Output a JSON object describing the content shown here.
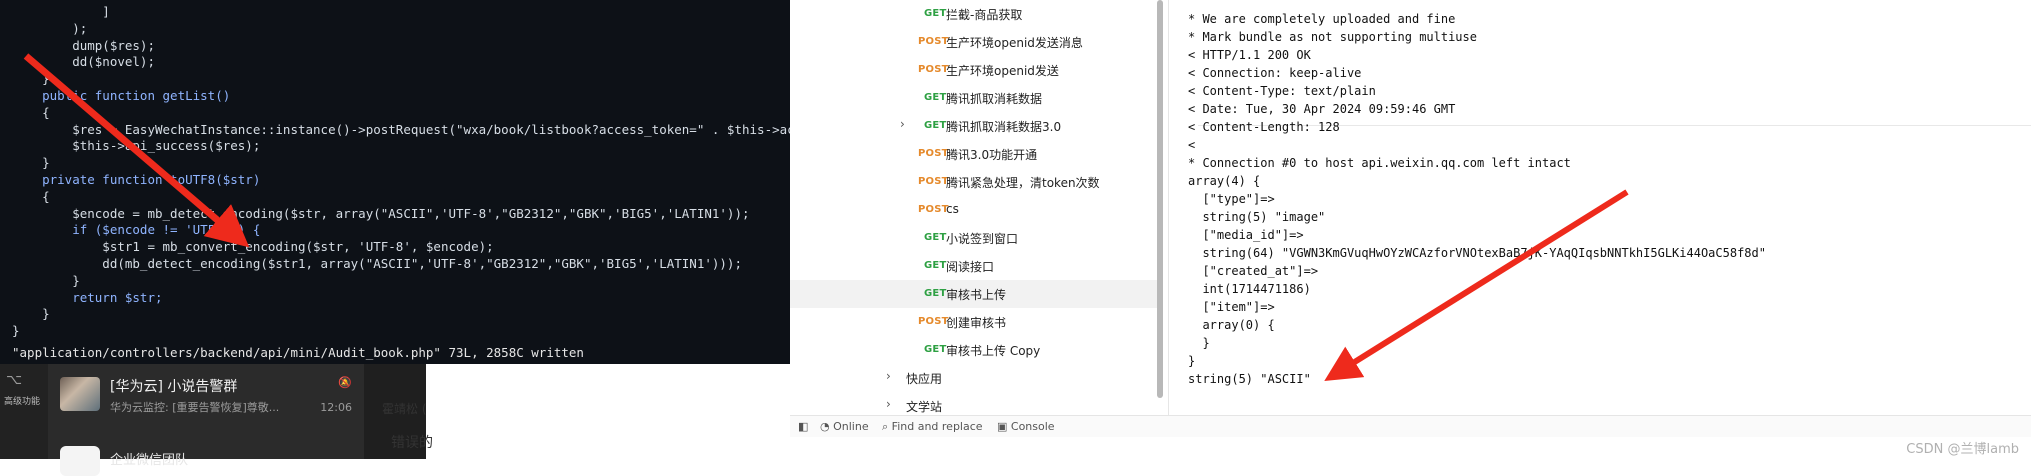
{
  "editor": {
    "lines": [
      "            ]",
      "        );",
      "        dump($res);",
      "        dd($novel);",
      "    }",
      "    public function getList()",
      "    {",
      "        $res = EasyWechatInstance::instance()->postRequest(\"wxa/book/listbook?access_token=\" . $this->access_to",
      "        $this->api_success($res);",
      "    }",
      "    private function toUTF8($str)",
      "    {",
      "        $encode = mb_detect_encoding($str, array(\"ASCII\",'UTF-8',\"GB2312\",\"GBK\",'BIG5','LATIN1'));",
      "        if ($encode != 'UTF-8') {",
      "            $str1 = mb_convert_encoding($str, 'UTF-8', $encode);",
      "            dd(mb_detect_encoding($str1, array(\"ASCII\",'UTF-8',\"GB2312\",\"GBK\",'BIG5','LATIN1')));",
      "        }",
      "        return $str;",
      "    }",
      "}"
    ],
    "status_line": "\"application/controllers/backend/api/mini/Audit_book.php\" 73L, 2858C written"
  },
  "chat": {
    "side_label": "高级功能",
    "items": [
      {
        "name": "[华为云] 小说告警群",
        "preview": "华为云监控: [重要告警恢复]尊敬...",
        "time": "12:06"
      },
      {
        "name": "企业微信团队",
        "preview": "",
        "time": ""
      }
    ],
    "main_title": "霍靖松 (",
    "main_sub": "错误的"
  },
  "tree": {
    "items": [
      {
        "method": "GET",
        "label": "拦截-商品获取",
        "indent": 2
      },
      {
        "method": "POST",
        "label": "生产环境openid发送消息",
        "indent": 2
      },
      {
        "method": "POST",
        "label": "生产环境openid发送",
        "indent": 2
      },
      {
        "method": "GET",
        "label": "腾讯抓取消耗数据",
        "indent": 2
      },
      {
        "method": "GET",
        "label": "腾讯抓取消耗数据3.0",
        "indent": 2,
        "chevron": "›"
      },
      {
        "method": "POST",
        "label": "腾讯3.0功能开通",
        "indent": 2
      },
      {
        "method": "POST",
        "label": "腾讯紧急处理，清token次数",
        "indent": 2
      },
      {
        "method": "POST",
        "label": "cs",
        "indent": 2
      },
      {
        "method": "GET",
        "label": "小说签到窗口",
        "indent": 2
      },
      {
        "method": "GET",
        "label": "阅读接口",
        "indent": 2
      },
      {
        "method": "GET",
        "label": "审核书上传",
        "indent": 2,
        "active": true
      },
      {
        "method": "POST",
        "label": "创建审核书",
        "indent": 2
      },
      {
        "method": "GET",
        "label": "审核书上传 Copy",
        "indent": 2
      },
      {
        "method": "",
        "label": "快应用",
        "indent": 1,
        "chevron": "›"
      },
      {
        "method": "",
        "label": "文学站",
        "indent": 1,
        "chevron": "›"
      }
    ]
  },
  "output": {
    "lines": [
      "* We are completely uploaded and fine",
      "* Mark bundle as not supporting multiuse",
      "< HTTP/1.1 200 OK",
      "< Connection: keep-alive",
      "< Content-Type: text/plain",
      "< Date: Tue, 30 Apr 2024 09:59:46 GMT",
      "< Content-Length: 128",
      "<",
      "* Connection #0 to host api.weixin.qq.com left intact",
      "array(4) {",
      "  [\"type\"]=>",
      "  string(5) \"image\"",
      "  [\"media_id\"]=>",
      "  string(64) \"VGWN3KmGVuqHwOYzWCAzforVNOtexBaB7jK-YAqQIqsbNNTkhI5GLKi44OaC58f8d\"",
      "  [\"created_at\"]=>",
      "  int(1714471186)",
      "  [\"item\"]=>",
      "  array(0) {",
      "  }",
      "}",
      "string(5) \"ASCII\""
    ]
  },
  "statusbar": {
    "online": "Online",
    "find_replace": "Find and replace",
    "console": "Console"
  },
  "watermark": "CSDN @兰博lamb",
  "colors": {
    "get": "#2ea043",
    "post": "#e58a2c",
    "arrow": "#ee2a1c"
  }
}
